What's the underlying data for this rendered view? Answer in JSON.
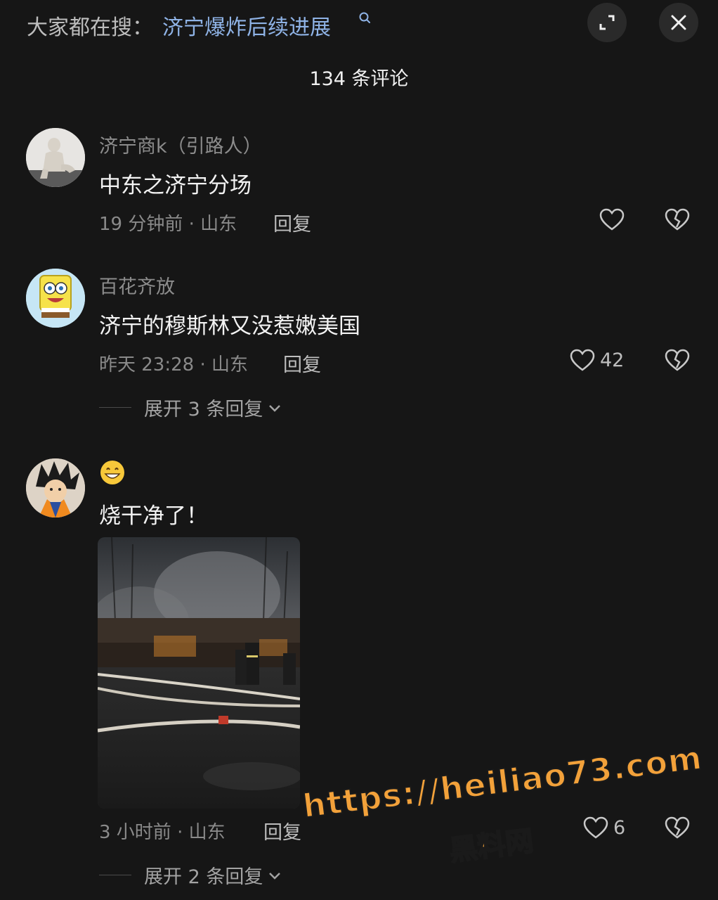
{
  "search": {
    "prefix": "大家都在搜：",
    "topic": "济宁爆炸后续进展"
  },
  "header": {
    "title": "134 条评论"
  },
  "comments": [
    {
      "username": "济宁商k（引路人）",
      "text": "中东之济宁分场",
      "meta": "19 分钟前 · 山东",
      "reply_label": "回复",
      "likes": ""
    },
    {
      "username": "百花齐放",
      "text": "济宁的穆斯林又没惹嫩美国",
      "meta": "昨天 23:28 · 山东",
      "reply_label": "回复",
      "likes": "42",
      "expand_label": "展开 3 条回复"
    },
    {
      "username_emoji": "grinning-face",
      "text": "烧干净了！",
      "meta": "3 小时前 · 山东",
      "reply_label": "回复",
      "likes": "6",
      "expand_label": "展开 2 条回复"
    }
  ],
  "watermark": {
    "url": "https://heiliao73.com",
    "name": "黑料网"
  },
  "colors": {
    "background": "#161616",
    "link_blue": "#8fb3e6",
    "watermark_orange": "#f2a13a"
  }
}
